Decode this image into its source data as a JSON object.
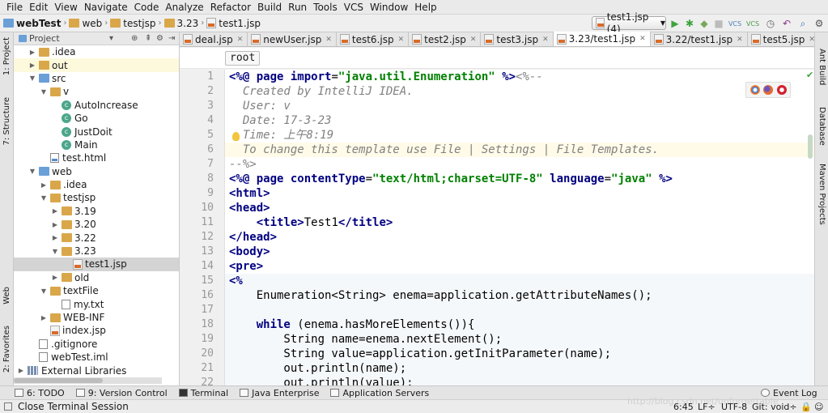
{
  "menu": [
    "File",
    "Edit",
    "View",
    "Navigate",
    "Code",
    "Analyze",
    "Refactor",
    "Build",
    "Run",
    "Tools",
    "VCS",
    "Window",
    "Help"
  ],
  "breadcrumbs": [
    "webTest",
    "web",
    "testjsp",
    "3.23",
    "test1.jsp"
  ],
  "run_config": "test1.jsp (4)",
  "left_tool_tabs": [
    "1: Project",
    "7: Structure",
    "Web",
    "2: Favorites"
  ],
  "right_tool_tabs": [
    "Ant Build",
    "Database",
    "Maven Projects"
  ],
  "project_panel": {
    "title": "Project",
    "tree": [
      {
        "label": ".idea",
        "depth": 1,
        "icon": "folder",
        "arrow": "right"
      },
      {
        "label": "out",
        "depth": 1,
        "icon": "folder",
        "arrow": "right"
      },
      {
        "label": "src",
        "depth": 1,
        "icon": "folder-blue",
        "arrow": "down"
      },
      {
        "label": "v",
        "depth": 2,
        "icon": "package",
        "arrow": "down"
      },
      {
        "label": "AutoIncrease",
        "depth": 3,
        "icon": "class",
        "arrow": "none"
      },
      {
        "label": "Go",
        "depth": 3,
        "icon": "class",
        "arrow": "none"
      },
      {
        "label": "JustDoit",
        "depth": 3,
        "icon": "class",
        "arrow": "none"
      },
      {
        "label": "Main",
        "depth": 3,
        "icon": "class",
        "arrow": "none"
      },
      {
        "label": "test.html",
        "depth": 2,
        "icon": "html",
        "arrow": "none"
      },
      {
        "label": "web",
        "depth": 1,
        "icon": "folder-blue",
        "arrow": "down"
      },
      {
        "label": ".idea",
        "depth": 2,
        "icon": "folder",
        "arrow": "right"
      },
      {
        "label": "testjsp",
        "depth": 2,
        "icon": "folder",
        "arrow": "down"
      },
      {
        "label": "3.19",
        "depth": 3,
        "icon": "folder",
        "arrow": "right"
      },
      {
        "label": "3.20",
        "depth": 3,
        "icon": "folder",
        "arrow": "right"
      },
      {
        "label": "3.22",
        "depth": 3,
        "icon": "folder",
        "arrow": "right"
      },
      {
        "label": "3.23",
        "depth": 3,
        "icon": "folder",
        "arrow": "down"
      },
      {
        "label": "test1.jsp",
        "depth": 4,
        "icon": "jsp",
        "arrow": "none",
        "selected": true
      },
      {
        "label": "old",
        "depth": 3,
        "icon": "folder",
        "arrow": "right"
      },
      {
        "label": "textFile",
        "depth": 2,
        "icon": "folder",
        "arrow": "down"
      },
      {
        "label": "my.txt",
        "depth": 3,
        "icon": "text",
        "arrow": "none"
      },
      {
        "label": "WEB-INF",
        "depth": 2,
        "icon": "folder",
        "arrow": "right"
      },
      {
        "label": "index.jsp",
        "depth": 2,
        "icon": "jsp",
        "arrow": "none"
      },
      {
        "label": ".gitignore",
        "depth": 1,
        "icon": "text",
        "arrow": "none"
      },
      {
        "label": "webTest.iml",
        "depth": 1,
        "icon": "text",
        "arrow": "none"
      },
      {
        "label": "External Libraries",
        "depth": 0,
        "icon": "library",
        "arrow": "right"
      }
    ]
  },
  "editor_tabs": [
    {
      "label": "deal.jsp",
      "active": false
    },
    {
      "label": "newUser.jsp",
      "active": false
    },
    {
      "label": "test6.jsp",
      "active": false
    },
    {
      "label": "test2.jsp",
      "active": false
    },
    {
      "label": "test3.jsp",
      "active": false
    },
    {
      "label": "3.23/test1.jsp",
      "active": true
    },
    {
      "label": "3.22/test1.jsp",
      "active": false
    },
    {
      "label": "test5.jsp",
      "active": false
    }
  ],
  "editor_breadcrumb": "root",
  "code_lines": [
    {
      "n": "1",
      "t": [
        [
          "kw",
          "<%@ page "
        ],
        [
          "kw",
          "import"
        ],
        [
          "plain",
          "="
        ],
        [
          "str",
          "\"java.util.Enumeration\""
        ],
        [
          "plain",
          " "
        ],
        [
          "kw",
          "%>"
        ],
        [
          "cm",
          "<%--"
        ]
      ]
    },
    {
      "n": "2",
      "t": [
        [
          "cm",
          "  Created by IntelliJ IDEA."
        ]
      ]
    },
    {
      "n": "3",
      "t": [
        [
          "cm",
          "  User: v"
        ]
      ]
    },
    {
      "n": "4",
      "t": [
        [
          "cm",
          "  Date: 17-3-23"
        ]
      ]
    },
    {
      "n": "5",
      "t": [
        [
          "cm",
          "  Time: 上午8:19"
        ]
      ]
    },
    {
      "n": "6",
      "t": [
        [
          "cm",
          "  To change this template use File | Settings | File Templates."
        ]
      ],
      "caret": true
    },
    {
      "n": "7",
      "t": [
        [
          "cm",
          "--%>"
        ]
      ]
    },
    {
      "n": "8",
      "t": [
        [
          "kw",
          "<%@ page "
        ],
        [
          "kw",
          "contentType"
        ],
        [
          "plain",
          "="
        ],
        [
          "str",
          "\"text/html;charset=UTF-8\""
        ],
        [
          "plain",
          " "
        ],
        [
          "kw",
          "language"
        ],
        [
          "plain",
          "="
        ],
        [
          "str",
          "\"java\""
        ],
        [
          "plain",
          " "
        ],
        [
          "kw",
          "%>"
        ]
      ]
    },
    {
      "n": "9",
      "t": [
        [
          "kw",
          "<html>"
        ]
      ]
    },
    {
      "n": "10",
      "t": [
        [
          "kw",
          "<head>"
        ]
      ]
    },
    {
      "n": "11",
      "t": [
        [
          "plain",
          "    "
        ],
        [
          "kw",
          "<title>"
        ],
        [
          "plain",
          "Test1"
        ],
        [
          "kw",
          "</title>"
        ]
      ]
    },
    {
      "n": "12",
      "t": [
        [
          "kw",
          "</head>"
        ]
      ]
    },
    {
      "n": "13",
      "t": [
        [
          "kw",
          "<body>"
        ]
      ]
    },
    {
      "n": "14",
      "t": [
        [
          "kw",
          "<pre>"
        ]
      ]
    },
    {
      "n": "15",
      "t": [
        [
          "kw",
          "<%"
        ]
      ],
      "java": true
    },
    {
      "n": "16",
      "t": [
        [
          "plain",
          "    Enumeration<String> enema=application.getAttributeNames();"
        ]
      ],
      "java": true
    },
    {
      "n": "17",
      "t": [
        [
          "plain",
          " "
        ]
      ],
      "java": true
    },
    {
      "n": "18",
      "t": [
        [
          "plain",
          "    "
        ],
        [
          "kw",
          "while"
        ],
        [
          "plain",
          " (enema.hasMoreElements()){"
        ]
      ],
      "java": true
    },
    {
      "n": "19",
      "t": [
        [
          "plain",
          "        String name=enema.nextElement();"
        ]
      ],
      "java": true
    },
    {
      "n": "20",
      "t": [
        [
          "plain",
          "        String value=application.getInitParameter(name);"
        ]
      ],
      "java": true
    },
    {
      "n": "21",
      "t": [
        [
          "plain",
          "        out.println(name);"
        ]
      ],
      "java": true
    },
    {
      "n": "22",
      "t": [
        [
          "plain",
          "        out.println(value);"
        ]
      ],
      "java": true
    }
  ],
  "bottom_tools": [
    "6: TODO",
    "9: Version Control",
    "Terminal",
    "Java Enterprise",
    "Application Servers"
  ],
  "event_log": "Event Log",
  "status": {
    "message": "Close Terminal Session",
    "position": "6:45",
    "line_sep": "LF÷",
    "encoding": "UTF-8",
    "git": "Git: void÷"
  },
  "watermark": "http://blog.csdn.net/unforgettable"
}
